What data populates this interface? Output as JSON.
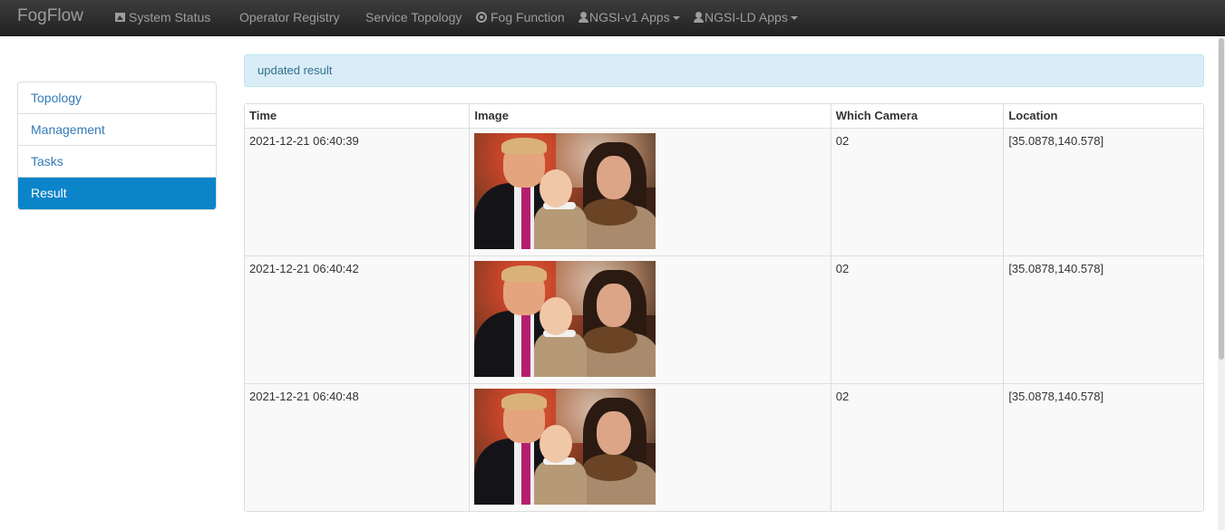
{
  "navbar": {
    "brand": "FogFlow",
    "items": [
      {
        "label": "System Status",
        "icon": "picture-icon"
      },
      {
        "label": "Operator Registry",
        "icon": "list-icon"
      },
      {
        "label": "Service Topology",
        "icon": "grid-icon"
      },
      {
        "label": "Fog Function",
        "icon": "target-icon"
      },
      {
        "label": "NGSI-v1 Apps",
        "icon": "user-icon",
        "dropdown": true
      },
      {
        "label": "NGSI-LD Apps",
        "icon": "user-icon",
        "dropdown": true
      }
    ]
  },
  "sidebar": {
    "items": [
      {
        "label": "Topology"
      },
      {
        "label": "Management"
      },
      {
        "label": "Tasks"
      },
      {
        "label": "Result",
        "active": true
      }
    ]
  },
  "alert": {
    "text": "updated result"
  },
  "table": {
    "headers": [
      "Time",
      "Image",
      "Which Camera",
      "Location"
    ],
    "rows": [
      {
        "time": "2021-12-21 06:40:39",
        "camera": "02",
        "location": "[35.0878,140.578]"
      },
      {
        "time": "2021-12-21 06:40:42",
        "camera": "02",
        "location": "[35.0878,140.578]"
      },
      {
        "time": "2021-12-21 06:40:48",
        "camera": "02",
        "location": "[35.0878,140.578]"
      }
    ]
  },
  "colors": {
    "navbar_bg": "#222222",
    "active_item": "#0b84c9",
    "link": "#337ab7",
    "alert_bg": "#d9edf7",
    "alert_text": "#31708f"
  }
}
